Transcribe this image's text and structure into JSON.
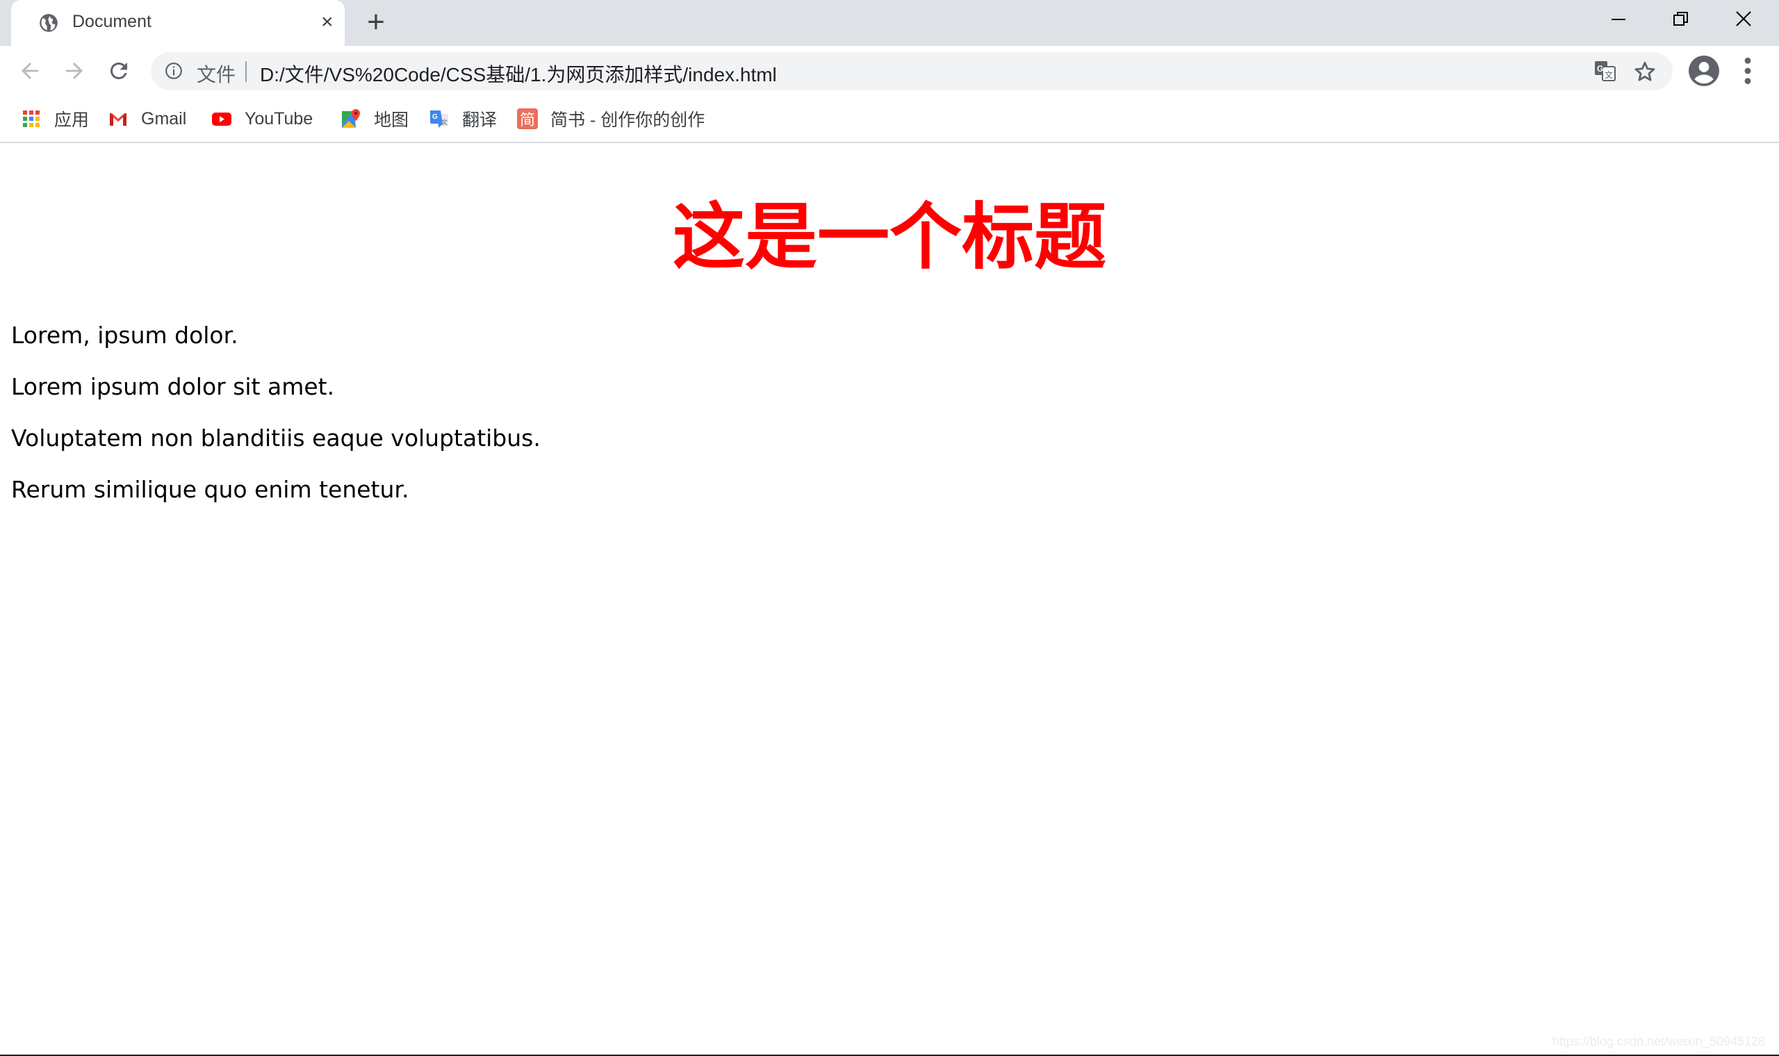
{
  "browser": {
    "tab": {
      "title": "Document",
      "favicon": "globe-icon",
      "close_icon": "×"
    },
    "new_tab_icon": "+",
    "window_controls": [
      "minimize-icon",
      "restore-icon",
      "close-icon"
    ],
    "toolbar": {
      "back_icon": "arrow-left-icon",
      "forward_icon": "arrow-right-icon",
      "reload_icon": "reload-icon",
      "omnibox": {
        "security_icon": "info-icon",
        "scheme_label": "文件",
        "url": "D:/文件/VS%20Code/CSS基础/1.为网页添加样式/index.html"
      },
      "translate_icon": "translate-icon",
      "bookmark_star_icon": "star-icon",
      "profile_icon": "account-circle-icon",
      "menu_icon": "more-vert-icon"
    },
    "bookmarks": [
      {
        "label": "应用",
        "icon": "apps-grid-icon"
      },
      {
        "label": "Gmail",
        "icon": "gmail-icon"
      },
      {
        "label": "YouTube",
        "icon": "youtube-icon"
      },
      {
        "label": "地图",
        "icon": "maps-icon"
      },
      {
        "label": "翻译",
        "icon": "google-translate-icon"
      },
      {
        "label": "简书 - 创作你的创作",
        "icon": "jianshu-icon",
        "icon_text": "简"
      }
    ]
  },
  "page": {
    "heading": "这是一个标题",
    "heading_color": "#ff0000",
    "paragraphs": [
      "Lorem, ipsum dolor.",
      "Lorem ipsum dolor sit amet.",
      "Voluptatem non blanditiis eaque voluptatibus.",
      "Rerum similique quo enim tenetur."
    ]
  },
  "watermark": "https://blog.csdn.net/weixin_50945128"
}
